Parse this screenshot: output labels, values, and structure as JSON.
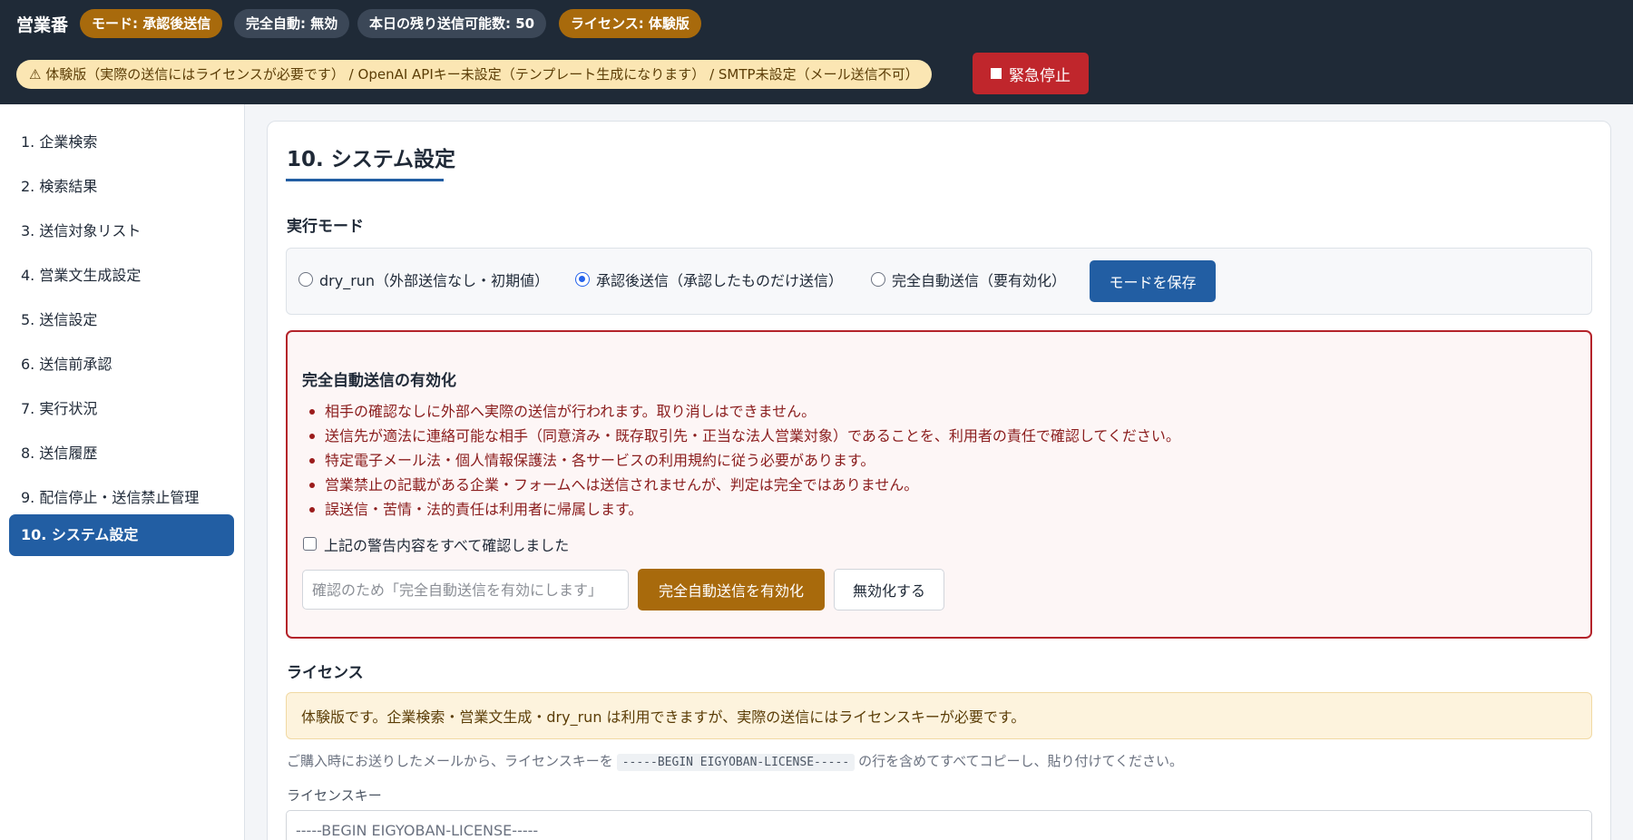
{
  "header": {
    "brand": "営業番",
    "badges": [
      "モード: 承認後送信",
      "完全自動: 無効",
      "本日の残り送信可能数: 50",
      "ライセンス: 体験版"
    ],
    "warning": "⚠ 体験版（実際の送信にはライセンスが必要です） / OpenAI APIキー未設定（テンプレート生成になります） / SMTP未設定（メール送信不可）",
    "emergency_stop": "緊急停止"
  },
  "sidebar": {
    "items": [
      {
        "label": "1. 企業検索"
      },
      {
        "label": "2. 検索結果"
      },
      {
        "label": "3. 送信対象リスト"
      },
      {
        "label": "4. 営業文生成設定"
      },
      {
        "label": "5. 送信設定"
      },
      {
        "label": "6. 送信前承認"
      },
      {
        "label": "7. 実行状況"
      },
      {
        "label": "8. 送信履歴"
      },
      {
        "label": "9. 配信停止・送信禁止管理"
      },
      {
        "label": "10. システム設定",
        "active": true
      }
    ]
  },
  "main": {
    "title": "10. システム設定",
    "mode": {
      "heading": "実行モード",
      "options": [
        {
          "label": "dry_run（外部送信なし・初期値）",
          "checked": false
        },
        {
          "label": "承認後送信（承認したものだけ送信）",
          "checked": true
        },
        {
          "label": "完全自動送信（要有効化）",
          "checked": false
        }
      ],
      "save_button": "モードを保存"
    },
    "auto": {
      "heading": "完全自動送信の有効化",
      "warnings": [
        "相手の確認なしに外部へ実際の送信が行われます。取り消しはできません。",
        "送信先が適法に連絡可能な相手（同意済み・既存取引先・正当な法人営業対象）であることを、利用者の責任で確認してください。",
        "特定電子メール法・個人情報保護法・各サービスの利用規約に従う必要があります。",
        "営業禁止の記載がある企業・フォームへは送信されませんが、判定は完全ではありません。",
        "誤送信・苦情・法的責任は利用者に帰属します。"
      ],
      "ack_label": "上記の警告内容をすべて確認しました",
      "ack_checked": false,
      "confirm_placeholder": "確認のため「完全自動送信を有効にします」",
      "enable_button": "完全自動送信を有効化",
      "disable_button": "無効化する"
    },
    "license": {
      "heading": "ライセンス",
      "notice": "体験版です。企業検索・営業文生成・dry_run は利用できますが、実際の送信にはライセンスキーが必要です。",
      "help_before": "ご購入時にお送りしたメールから、ライセンスキーを",
      "help_code": "-----BEGIN EIGYOBAN-LICENSE-----",
      "help_after": "の行を含めてすべてコピーし、貼り付けてください。",
      "field_label": "ライセンスキー",
      "key_placeholder": "-----BEGIN EIGYOBAN-LICENSE-----"
    }
  },
  "colors": {
    "topbar": "#1f2a37",
    "primary": "#225ea3",
    "amber": "#a86a0c",
    "danger": "#b4232a"
  }
}
